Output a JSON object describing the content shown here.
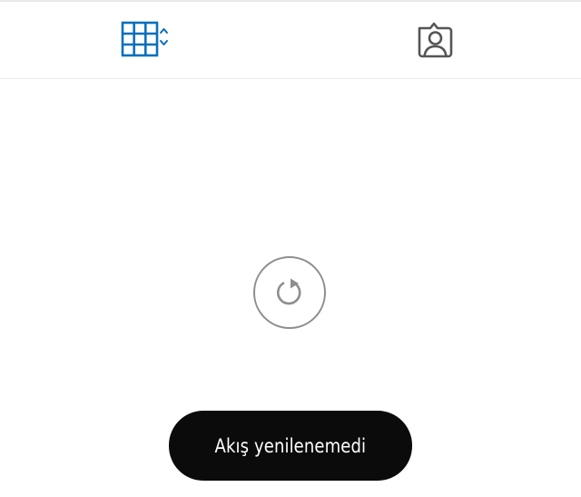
{
  "tabs": [
    {
      "name": "grid-view",
      "icon": "grid-icon",
      "selected": true,
      "color": "#0a6fbd"
    },
    {
      "name": "tagged-photos",
      "icon": "tagged-person-icon",
      "selected": false,
      "color": "#555555"
    }
  ],
  "refresh": {
    "icon": "refresh-icon",
    "color": "#8e8e8e"
  },
  "toast": {
    "message": "Akış yenilenemedi",
    "background": "#0b0b0b",
    "text_color": "#ffffff"
  }
}
